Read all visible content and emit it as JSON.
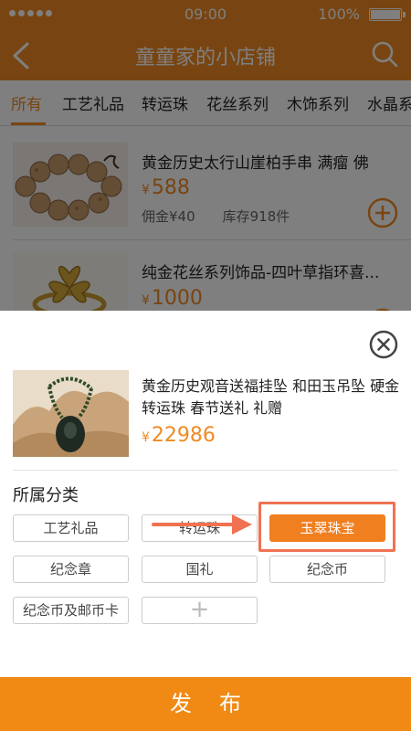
{
  "status": {
    "time": "09:00",
    "battery": "100%",
    "battery_level": 1.0
  },
  "nav": {
    "title": "童童家的小店铺"
  },
  "tabs": [
    {
      "label": "所有",
      "active": true
    },
    {
      "label": "工艺礼品"
    },
    {
      "label": "转运珠"
    },
    {
      "label": "花丝系列"
    },
    {
      "label": "木饰系列"
    },
    {
      "label": "水晶系"
    }
  ],
  "products": [
    {
      "name": "黄金历史太行山崖柏手串 满瘤 佛",
      "currency": "¥",
      "price": "588",
      "commission": "佣金¥40",
      "stock": "库存918件"
    },
    {
      "name": "纯金花丝系列饰品-四叶草指环喜...",
      "currency": "¥",
      "price": "1000"
    }
  ],
  "sheet": {
    "product": {
      "name": "黄金历史观音送福挂坠 和田玉吊坠 硬金转运珠 春节送礼 礼赠",
      "currency": "¥",
      "price": "22986"
    },
    "section_title": "所属分类",
    "categories": [
      "工艺礼品",
      "转运珠",
      "玉翠珠宝",
      "纪念章",
      "国礼",
      "纪念币",
      "纪念币及邮币卡"
    ],
    "selected_category": "玉翠珠宝",
    "add_label": "+",
    "publish_label": "发布"
  },
  "colors": {
    "accent": "#f08a24",
    "annotation": "#f07252"
  }
}
